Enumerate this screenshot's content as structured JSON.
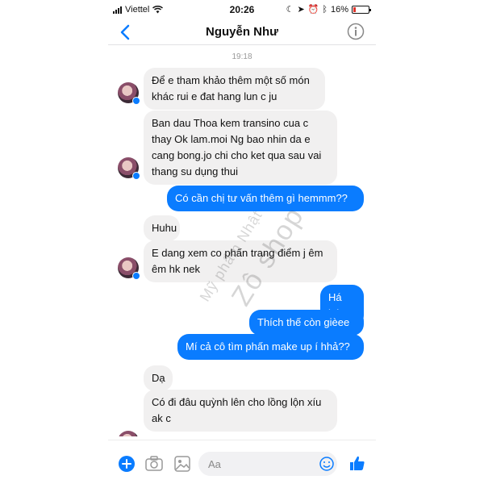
{
  "status_bar": {
    "carrier": "Viettel",
    "time": "20:26",
    "battery": "16%",
    "battery_level": 0.16
  },
  "header": {
    "contact_name": "Nguyễn Như"
  },
  "chat": {
    "timestamp": "19:18",
    "messages": [
      {
        "dir": "in",
        "text": "Để e tham khảo thêm một số món khác rui e đat hang lun c ju"
      },
      {
        "dir": "in",
        "text": "Ban dau Thoa kem transino cua c thay Ok lam.moi Ng bao nhin da e cang bong.jo chi cho ket qua sau vai thang su dụng thui"
      },
      {
        "dir": "out",
        "text": "Có cần chị tư vấn thêm gì hemmm??"
      },
      {
        "dir": "in",
        "text": "Huhu"
      },
      {
        "dir": "in",
        "text": "E dang xem co phấn trang điểm j êm êm hk nek"
      },
      {
        "dir": "out",
        "text": "Há há"
      },
      {
        "dir": "out",
        "text": "Thích thế còn gièee"
      },
      {
        "dir": "out",
        "text": "Mí cả cô tìm phấn make up í hhả??"
      },
      {
        "dir": "in",
        "text": "Dạ"
      },
      {
        "dir": "in",
        "text": "Có đi đâu quỳnh lên cho lồng lộn xíu ak c"
      }
    ],
    "watermark_small": "Mỹ phẩm Nhật",
    "watermark_big": "Zô shop"
  },
  "composer": {
    "placeholder": "Aa"
  },
  "colors": {
    "accent": "#0a7cff",
    "incoming_bubble": "#f1f0f0"
  }
}
